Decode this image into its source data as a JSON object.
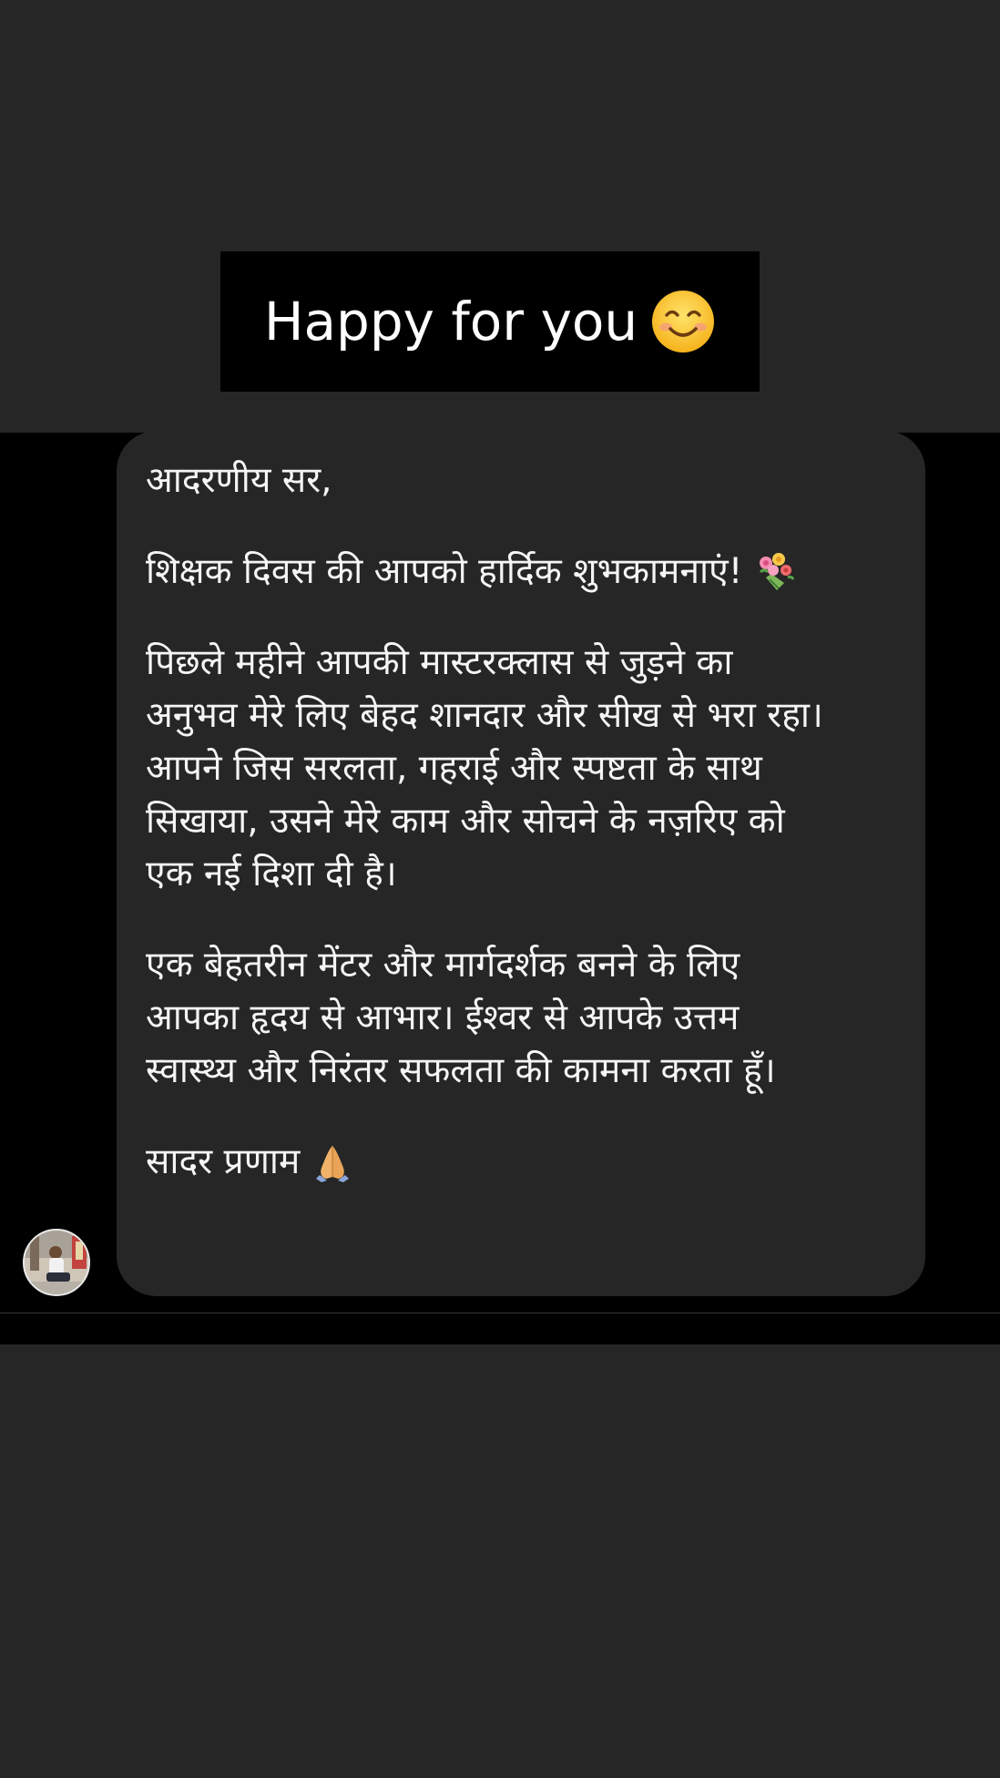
{
  "caption": {
    "text": "Happy for you",
    "emoji": "smiling-face-emoji"
  },
  "message": {
    "greeting": "आदरणीय सर,",
    "wish": "शिक्षक दिवस की आपको हार्दिक शुभकामनाएं!",
    "wish_emoji": "bouquet-emoji",
    "para1": [
      "पिछले महीने आपकी मास्टरक्लास से जुड़ने का",
      "अनुभव मेरे लिए बेहद शानदार और सीख से भरा रहा।",
      "आपने जिस सरलता, गहराई और स्पष्टता के साथ",
      "सिखाया, उसने मेरे काम और सोचने के नज़रिए को",
      "एक नई दिशा दी है।"
    ],
    "para2": [
      "एक बेहतरीन मेंटर और मार्गदर्शक बनने के लिए",
      "आपका हृदय से आभार। ईश्वर से आपके उत्तम",
      "स्वास्थ्य और निरंतर सफलता की कामना करता हूँ।"
    ],
    "signoff": "सादर प्रणाम",
    "signoff_emoji": "folded-hands-emoji"
  },
  "colors": {
    "background": "#262626",
    "band": "#000000",
    "bubble": "#262626",
    "text": "#f5f5f5",
    "caption_box": "#000000"
  }
}
